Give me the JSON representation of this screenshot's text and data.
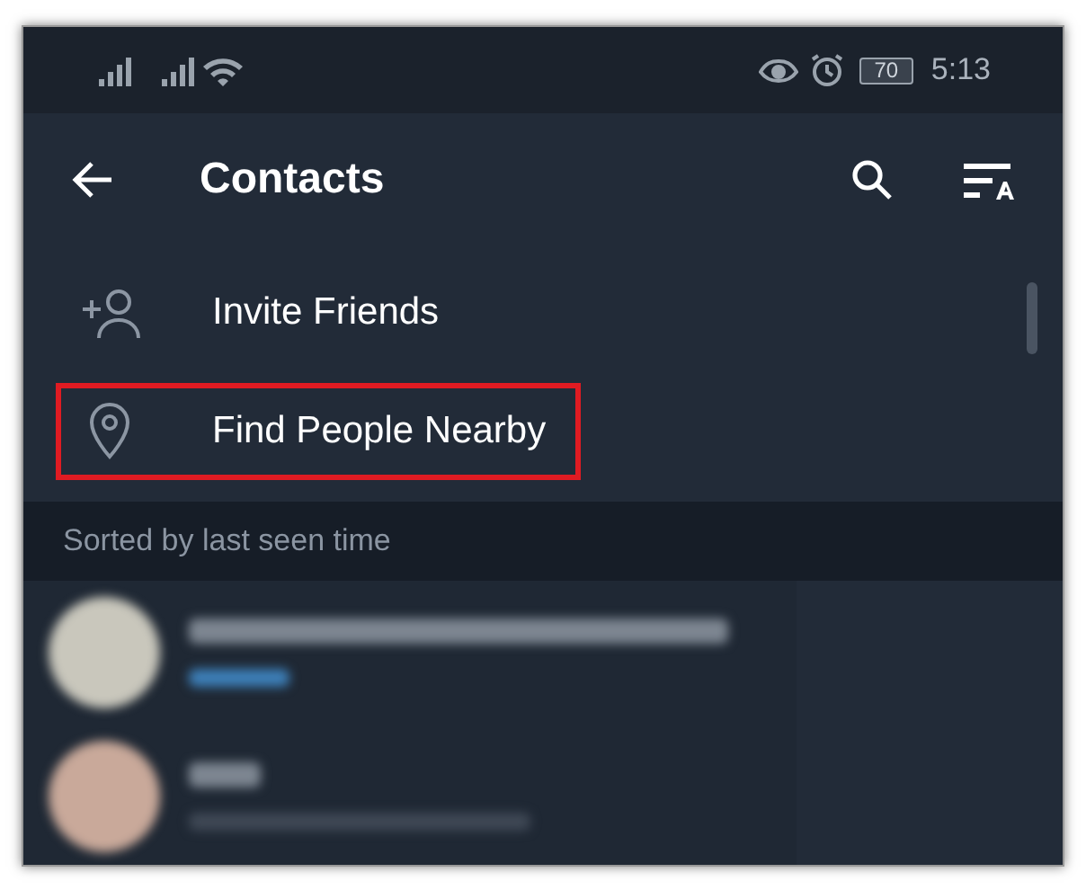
{
  "status_bar": {
    "battery": "70",
    "time": "5:13"
  },
  "app_bar": {
    "title": "Contacts"
  },
  "menu": [
    {
      "kind": "invite",
      "label": "Invite Friends",
      "highlighted": false
    },
    {
      "kind": "nearby",
      "label": "Find People Nearby",
      "highlighted": true
    }
  ],
  "section_header": "Sorted by last seen time",
  "contacts": [
    {
      "online": true
    },
    {
      "online": false
    }
  ]
}
